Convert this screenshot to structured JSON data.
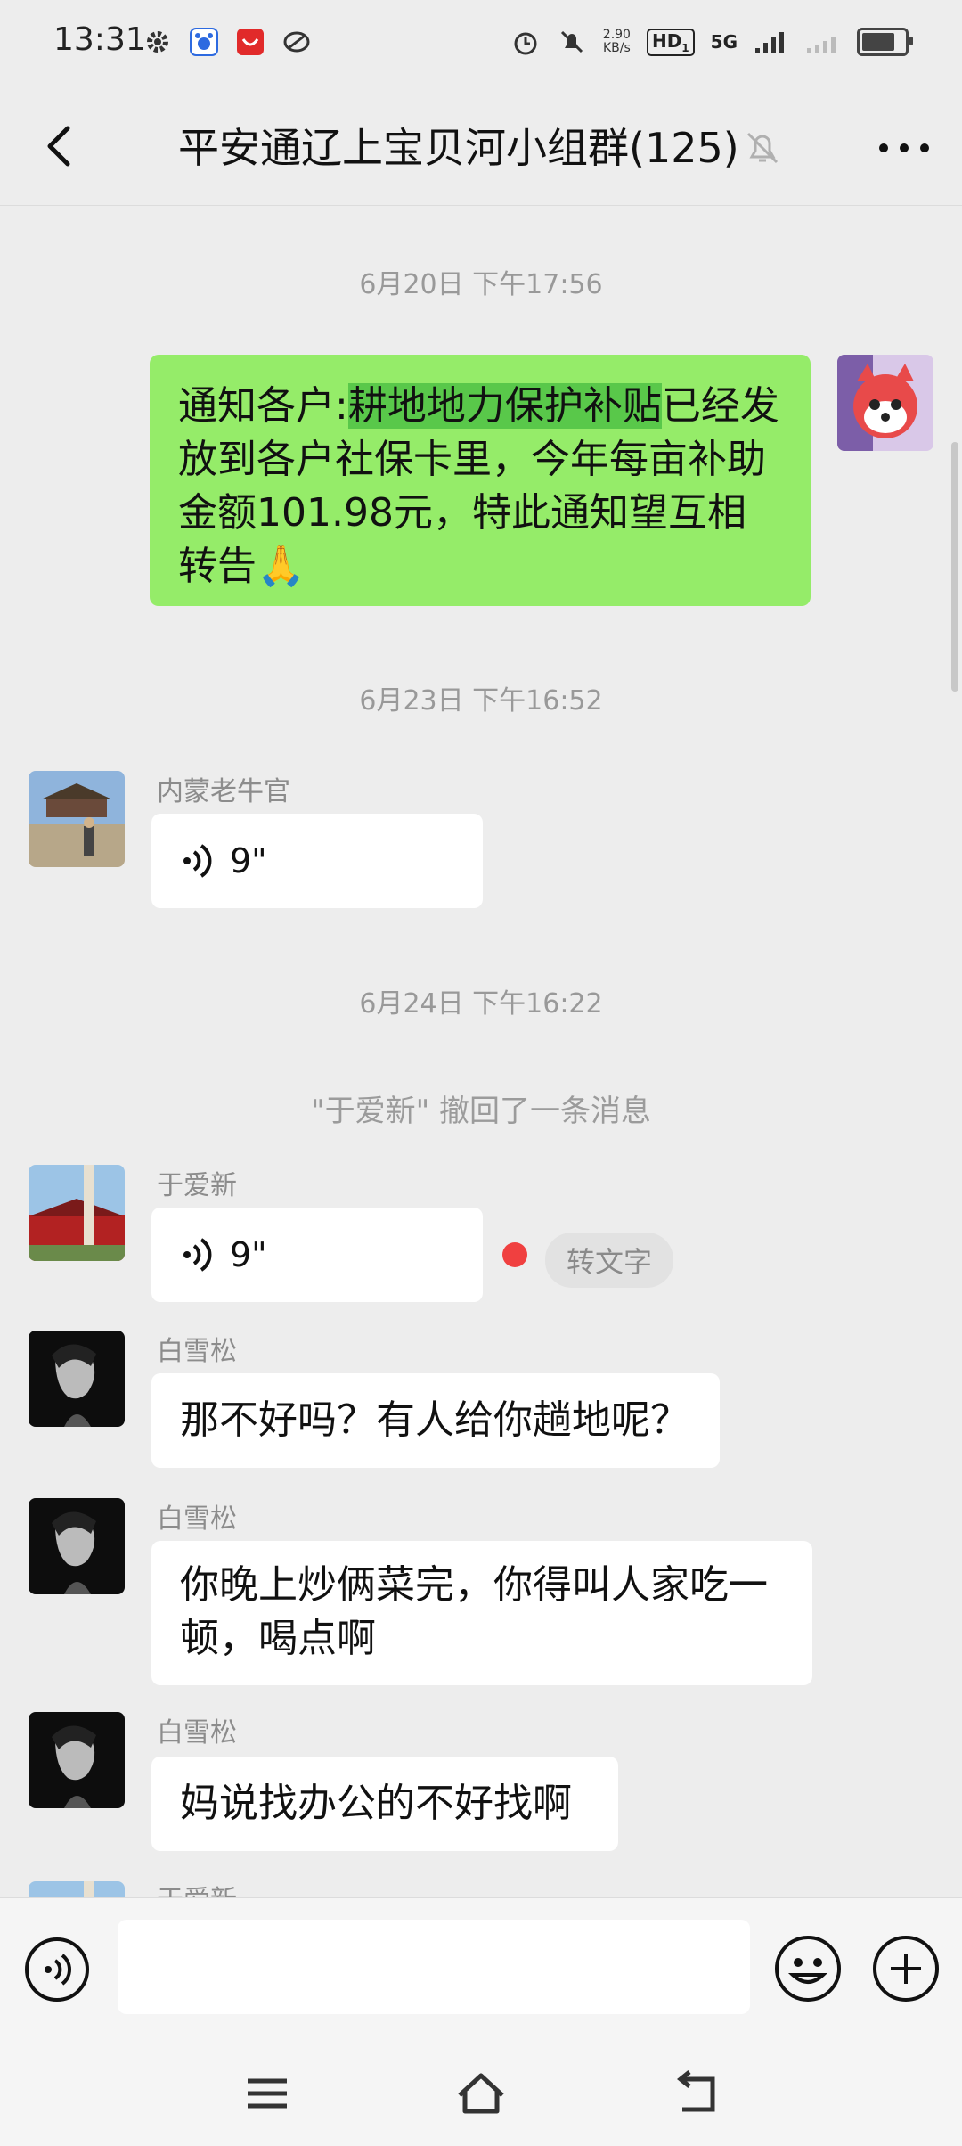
{
  "status_bar": {
    "time": "13:31",
    "net_speed_value": "2.90",
    "net_speed_unit": "KB/s",
    "hd_label": "HD",
    "hd_sub": "1",
    "signal_label": "5G",
    "battery_level": 0.8
  },
  "header": {
    "title": "平安通辽上宝贝河小组群(125)"
  },
  "messages": {
    "ts1": "6月20日 下午17:56",
    "msg1_prefix": "通知各户:",
    "msg1_highlight": "耕地地力保护补贴",
    "msg1_rest": "已经发放到各户社保卡里，今年每亩补助金额101.98元，特此通知望互相转告🙏",
    "ts2": "6月23日 下午16:52",
    "sender2": "内蒙老牛官",
    "voice2": "9\"",
    "ts3": "6月24日 下午16:22",
    "recall_notice": "\"于爱新\" 撤回了一条消息",
    "sender3": "于爱新",
    "voice3": "9\"",
    "to_text_button": "转文字",
    "sender4": "白雪松",
    "msg4": "那不好吗？有人给你趟地呢？",
    "sender5": "白雪松",
    "msg5": "你晚上炒俩菜完，你得叫人家吃一顿，喝点啊",
    "sender6": "白雪松",
    "msg6": "妈说找办公的不好找啊",
    "sender7": "于爱新"
  },
  "icons": {
    "back": "back-arrow-icon",
    "mute": "muted-bell-icon",
    "more": "more-dots-icon",
    "voice_input": "voice-input-icon",
    "emoji": "emoji-icon",
    "plus": "plus-icon"
  },
  "colors": {
    "own_bubble": "#95ec69",
    "highlight": "#59c84a",
    "unread_dot": "#f04040"
  }
}
